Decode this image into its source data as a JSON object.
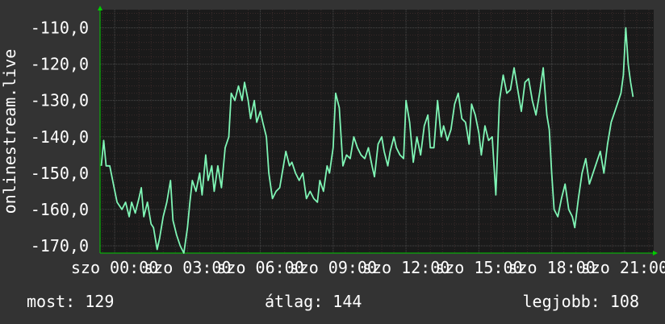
{
  "chart_data": {
    "type": "line",
    "ylabel": "onlinestream.live",
    "ylim": [
      -172,
      -105
    ],
    "yticks": [
      -110,
      -120,
      -130,
      -140,
      -150,
      -160,
      -170
    ],
    "ytick_labels": [
      "-110,0",
      "-120,0",
      "-130,0",
      "-140,0",
      "-150,0",
      "-160,0",
      "-170,0"
    ],
    "xticks": [
      {
        "label": "szo 00:00",
        "hour": 0
      },
      {
        "label": "szo 03:00",
        "hour": 3
      },
      {
        "label": "szo 06:00",
        "hour": 6
      },
      {
        "label": "szo 09:00",
        "hour": 9
      },
      {
        "label": "szo 12:00",
        "hour": 12
      },
      {
        "label": "szo 15:00",
        "hour": 15
      },
      {
        "label": "szo 18:00",
        "hour": 18
      },
      {
        "label": "szo 21:00",
        "hour": 21
      }
    ],
    "xlim": [
      -0.6,
      22.2
    ],
    "grid": true,
    "colors": {
      "background": "#333333",
      "plot": "#1a1a1a",
      "line": "#7ff5b5",
      "grid_major": "#4a4a4a",
      "grid_minor": "#3a2a2a",
      "axis": "#00cc00"
    },
    "series": [
      {
        "values": [
          [
            -0.55,
            -148
          ],
          [
            -0.45,
            -141
          ],
          [
            -0.35,
            -148
          ],
          [
            -0.2,
            -148
          ],
          [
            -0.05,
            -153
          ],
          [
            0.1,
            -158
          ],
          [
            0.3,
            -160
          ],
          [
            0.45,
            -158
          ],
          [
            0.6,
            -162
          ],
          [
            0.7,
            -158
          ],
          [
            0.85,
            -161
          ],
          [
            1.0,
            -157
          ],
          [
            1.1,
            -154
          ],
          [
            1.2,
            -162
          ],
          [
            1.35,
            -158
          ],
          [
            1.5,
            -164
          ],
          [
            1.6,
            -165
          ],
          [
            1.75,
            -171
          ],
          [
            1.85,
            -168
          ],
          [
            2.0,
            -162
          ],
          [
            2.15,
            -158
          ],
          [
            2.3,
            -152
          ],
          [
            2.4,
            -163
          ],
          [
            2.55,
            -167
          ],
          [
            2.7,
            -170
          ],
          [
            2.85,
            -172
          ],
          [
            3.0,
            -165
          ],
          [
            3.1,
            -158
          ],
          [
            3.2,
            -152
          ],
          [
            3.35,
            -155
          ],
          [
            3.5,
            -150
          ],
          [
            3.6,
            -156
          ],
          [
            3.75,
            -145
          ],
          [
            3.85,
            -152
          ],
          [
            4.0,
            -148
          ],
          [
            4.1,
            -155
          ],
          [
            4.25,
            -148
          ],
          [
            4.4,
            -154
          ],
          [
            4.55,
            -143
          ],
          [
            4.7,
            -140
          ],
          [
            4.8,
            -128
          ],
          [
            4.95,
            -130
          ],
          [
            5.1,
            -126
          ],
          [
            5.25,
            -130
          ],
          [
            5.35,
            -125
          ],
          [
            5.5,
            -130
          ],
          [
            5.6,
            -135
          ],
          [
            5.75,
            -130
          ],
          [
            5.85,
            -136
          ],
          [
            6.0,
            -133
          ],
          [
            6.1,
            -136
          ],
          [
            6.25,
            -140
          ],
          [
            6.35,
            -150
          ],
          [
            6.5,
            -157
          ],
          [
            6.65,
            -155
          ],
          [
            6.8,
            -154
          ],
          [
            6.95,
            -148
          ],
          [
            7.05,
            -144
          ],
          [
            7.2,
            -148
          ],
          [
            7.3,
            -147
          ],
          [
            7.45,
            -150
          ],
          [
            7.6,
            -152
          ],
          [
            7.75,
            -150
          ],
          [
            7.9,
            -157
          ],
          [
            8.05,
            -155
          ],
          [
            8.2,
            -157
          ],
          [
            8.35,
            -158
          ],
          [
            8.45,
            -152
          ],
          [
            8.6,
            -155
          ],
          [
            8.75,
            -148
          ],
          [
            8.85,
            -150
          ],
          [
            9.0,
            -143
          ],
          [
            9.1,
            -128
          ],
          [
            9.25,
            -132
          ],
          [
            9.4,
            -148
          ],
          [
            9.55,
            -145
          ],
          [
            9.7,
            -146
          ],
          [
            9.85,
            -140
          ],
          [
            10.0,
            -143
          ],
          [
            10.15,
            -145
          ],
          [
            10.3,
            -146
          ],
          [
            10.45,
            -143
          ],
          [
            10.6,
            -148
          ],
          [
            10.7,
            -151
          ],
          [
            10.85,
            -142
          ],
          [
            11.0,
            -140
          ],
          [
            11.1,
            -144
          ],
          [
            11.25,
            -148
          ],
          [
            11.35,
            -144
          ],
          [
            11.5,
            -140
          ],
          [
            11.6,
            -143
          ],
          [
            11.75,
            -145
          ],
          [
            11.9,
            -146
          ],
          [
            12.0,
            -130
          ],
          [
            12.15,
            -136
          ],
          [
            12.3,
            -147
          ],
          [
            12.45,
            -140
          ],
          [
            12.6,
            -145
          ],
          [
            12.75,
            -137
          ],
          [
            12.9,
            -134
          ],
          [
            13.0,
            -143
          ],
          [
            13.15,
            -143
          ],
          [
            13.3,
            -130
          ],
          [
            13.45,
            -140
          ],
          [
            13.55,
            -137
          ],
          [
            13.7,
            -141
          ],
          [
            13.85,
            -138
          ],
          [
            14.0,
            -131
          ],
          [
            14.15,
            -128
          ],
          [
            14.3,
            -135
          ],
          [
            14.45,
            -136
          ],
          [
            14.6,
            -142
          ],
          [
            14.7,
            -131
          ],
          [
            14.85,
            -134
          ],
          [
            15.0,
            -139
          ],
          [
            15.1,
            -145
          ],
          [
            15.25,
            -137
          ],
          [
            15.4,
            -141
          ],
          [
            15.55,
            -140
          ],
          [
            15.7,
            -156
          ],
          [
            15.85,
            -130
          ],
          [
            16.0,
            -123
          ],
          [
            16.15,
            -128
          ],
          [
            16.3,
            -127
          ],
          [
            16.45,
            -121
          ],
          [
            16.6,
            -127
          ],
          [
            16.75,
            -133
          ],
          [
            16.9,
            -125
          ],
          [
            17.05,
            -124
          ],
          [
            17.2,
            -130
          ],
          [
            17.35,
            -134
          ],
          [
            17.5,
            -128
          ],
          [
            17.65,
            -121
          ],
          [
            17.8,
            -134
          ],
          [
            17.9,
            -138
          ],
          [
            18.0,
            -150
          ],
          [
            18.1,
            -160
          ],
          [
            18.25,
            -162
          ],
          [
            18.4,
            -157
          ],
          [
            18.55,
            -153
          ],
          [
            18.7,
            -160
          ],
          [
            18.85,
            -162
          ],
          [
            18.95,
            -165
          ],
          [
            19.1,
            -157
          ],
          [
            19.25,
            -150
          ],
          [
            19.4,
            -146
          ],
          [
            19.55,
            -153
          ],
          [
            19.7,
            -150
          ],
          [
            19.85,
            -147
          ],
          [
            20.0,
            -144
          ],
          [
            20.15,
            -150
          ],
          [
            20.3,
            -142
          ],
          [
            20.45,
            -136
          ],
          [
            20.6,
            -133
          ],
          [
            20.75,
            -130
          ],
          [
            20.85,
            -128
          ],
          [
            20.95,
            -123
          ],
          [
            21.05,
            -110
          ],
          [
            21.15,
            -120
          ],
          [
            21.25,
            -125
          ],
          [
            21.35,
            -129
          ]
        ]
      }
    ]
  },
  "stats": {
    "now": "most: 129",
    "avg": "átlag: 144",
    "best": "legjobb: 108"
  }
}
